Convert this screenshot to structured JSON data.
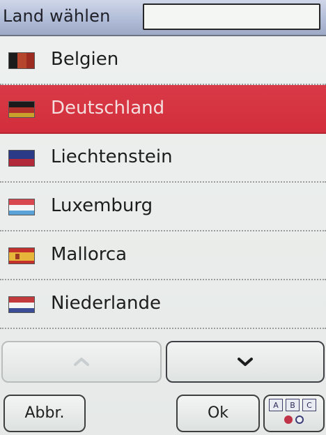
{
  "header": {
    "title": "Land wählen",
    "search_value": ""
  },
  "countries": [
    {
      "name": "Belgien",
      "flag": "belgium-flag",
      "selected": false
    },
    {
      "name": "Deutschland",
      "flag": "germany-flag",
      "selected": true
    },
    {
      "name": "Liechtenstein",
      "flag": "liechtenstein-flag",
      "selected": false
    },
    {
      "name": "Luxemburg",
      "flag": "luxembourg-flag",
      "selected": false
    },
    {
      "name": "Mallorca",
      "flag": "spain-flag",
      "selected": false
    },
    {
      "name": "Niederlande",
      "flag": "netherlands-flag",
      "selected": false
    }
  ],
  "scroll": {
    "up_icon": "chevron-up-icon",
    "down_icon": "chevron-down-icon"
  },
  "buttons": {
    "cancel_label": "Abbr.",
    "ok_label": "Ok",
    "keyboard_keys": [
      "A",
      "B",
      "C"
    ]
  },
  "colors": {
    "selection": "#d6343f",
    "header": "#aebad6"
  }
}
